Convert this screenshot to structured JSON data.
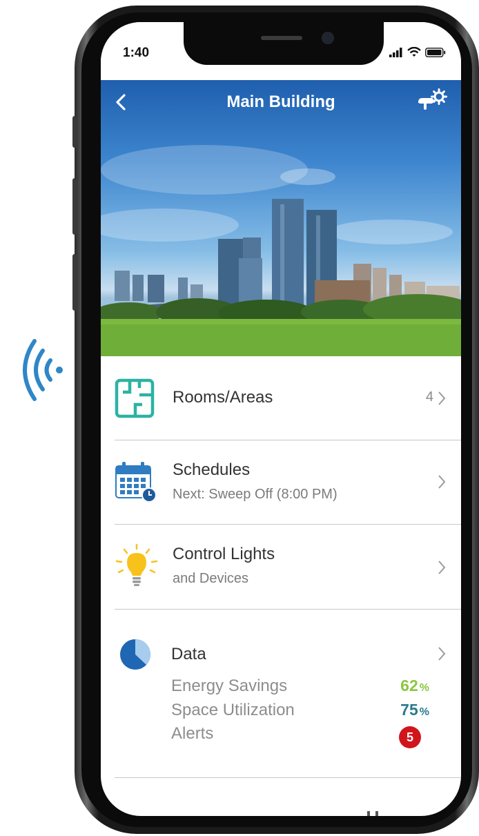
{
  "status_bar": {
    "time": "1:40",
    "icons": [
      "cellular-signal-icon",
      "wifi-icon",
      "battery-icon"
    ]
  },
  "nav": {
    "title": "Main Building",
    "back_icon": "chevron-left-icon",
    "settings_icon": "hand-gear-icon"
  },
  "hero": {
    "image": "city-skyline-over-grass-photo"
  },
  "menu": {
    "rooms": {
      "title": "Rooms/Areas",
      "count": "4",
      "icon": "floor-plan-icon"
    },
    "schedules": {
      "title": "Schedules",
      "subtitle": "Next: Sweep Off (8:00 PM)",
      "icon": "calendar-clock-icon"
    },
    "lights": {
      "title": "Control Lights",
      "subtitle": "and Devices",
      "icon": "lightbulb-icon"
    },
    "data": {
      "title": "Data",
      "icon": "pie-chart-icon",
      "energy_label": "Energy Savings",
      "energy_value": "62",
      "space_label": "Space Utilization",
      "space_value": "75",
      "percent_unit": "%",
      "alerts_label": "Alerts",
      "alerts_count": "5"
    }
  },
  "colors": {
    "energy_green": "#8cc63f",
    "space_teal": "#2a7a8c",
    "alert_red": "#d0161b",
    "floorplan_teal": "#2bb3a3",
    "calendar_blue": "#2f7cc0",
    "bulb_yellow": "#f7c21b"
  }
}
